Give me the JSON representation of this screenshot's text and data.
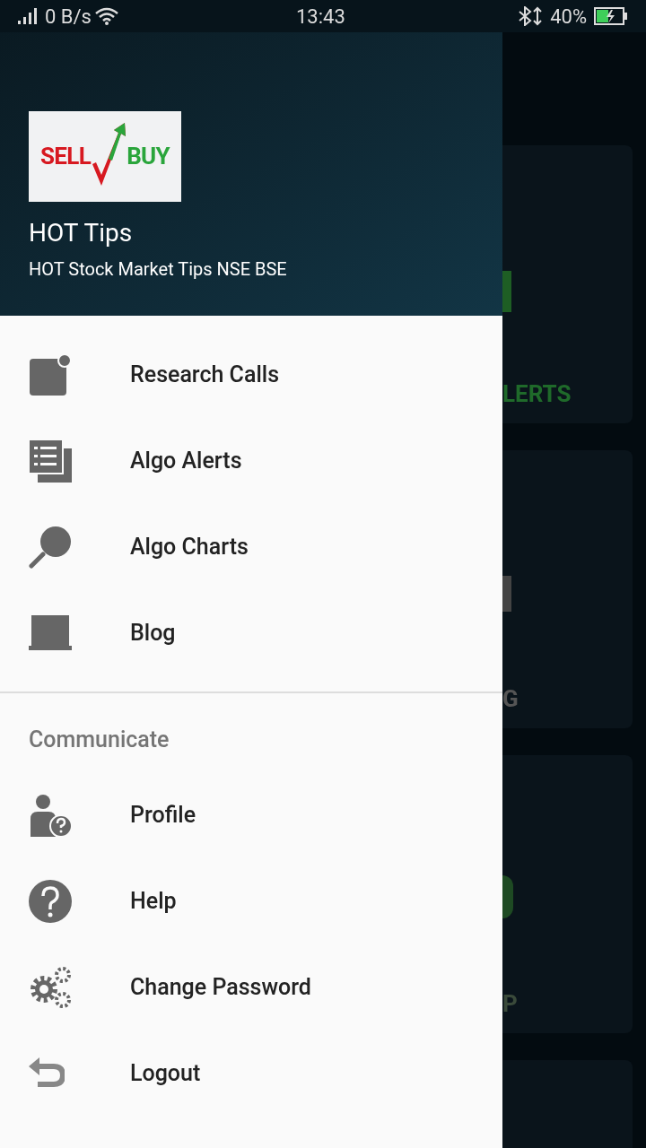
{
  "status_bar": {
    "speed": "0 B/s",
    "time": "13:43",
    "battery": "40%"
  },
  "background_cards": [
    {
      "label": "LERTS"
    },
    {
      "label": "G"
    },
    {
      "label": "P"
    }
  ],
  "drawer": {
    "logo": {
      "left": "SELL",
      "right": "BUY"
    },
    "title": "HOT Tips",
    "subtitle": "HOT Stock Market Tips NSE BSE",
    "items": [
      {
        "label": "Research Calls"
      },
      {
        "label": "Algo Alerts"
      },
      {
        "label": "Algo Charts"
      },
      {
        "label": "Blog"
      }
    ],
    "section": {
      "title": "Communicate",
      "items": [
        {
          "label": "Profile"
        },
        {
          "label": "Help"
        },
        {
          "label": "Change Password"
        },
        {
          "label": "Logout"
        }
      ]
    }
  }
}
